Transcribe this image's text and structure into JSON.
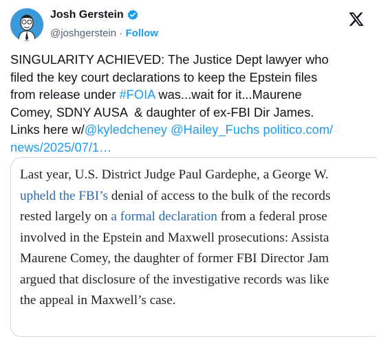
{
  "author": {
    "name": "Josh Gerstein",
    "handle": "@joshgerstein",
    "separator": "·",
    "follow_label": "Follow"
  },
  "tweet": {
    "text_1": "SINGULARITY ACHIEVED: The Justice Dept lawyer who\nfiled the key court declarations to keep the Epstein files\nfrom release under ",
    "hashtag": "#FOIA",
    "text_2": " was...wait for it...Maurene\nComey, SDNY AUSA  & daughter of ex-FBI Dir James.\nLinks here w/",
    "mention_1": "@kyledcheney",
    "space_1": " ",
    "mention_2": "@Hailey_Fuchs",
    "space_2": " ",
    "url": "politico.com/\nnews/2025/07/1…"
  },
  "card": {
    "l1": "Last year, U.S. District Judge Paul Gardephe, a George W.",
    "l2_link": "upheld the FBI’s",
    "l2_rest": " denial of access to the bulk of the records",
    "l3_pre": "rested largely on ",
    "l3_link": "a formal declaration",
    "l3_rest": " from a federal prose",
    "l4": "involved in the Epstein and Maxwell prosecutions: Assista",
    "l5": "Maurene Comey, the daughter of former FBI Director Jam",
    "l6": "argued that disclosure of the investigative records was like",
    "l7": "the appeal in Maxwell’s case."
  },
  "icons": {
    "avatar": "caricature-avatar",
    "verified": "verified-badge-icon",
    "logo": "x-logo-icon"
  },
  "colors": {
    "link": "#1d9bf0",
    "card_link": "#2d6aa8",
    "text": "#0f1419",
    "muted": "#536471"
  }
}
